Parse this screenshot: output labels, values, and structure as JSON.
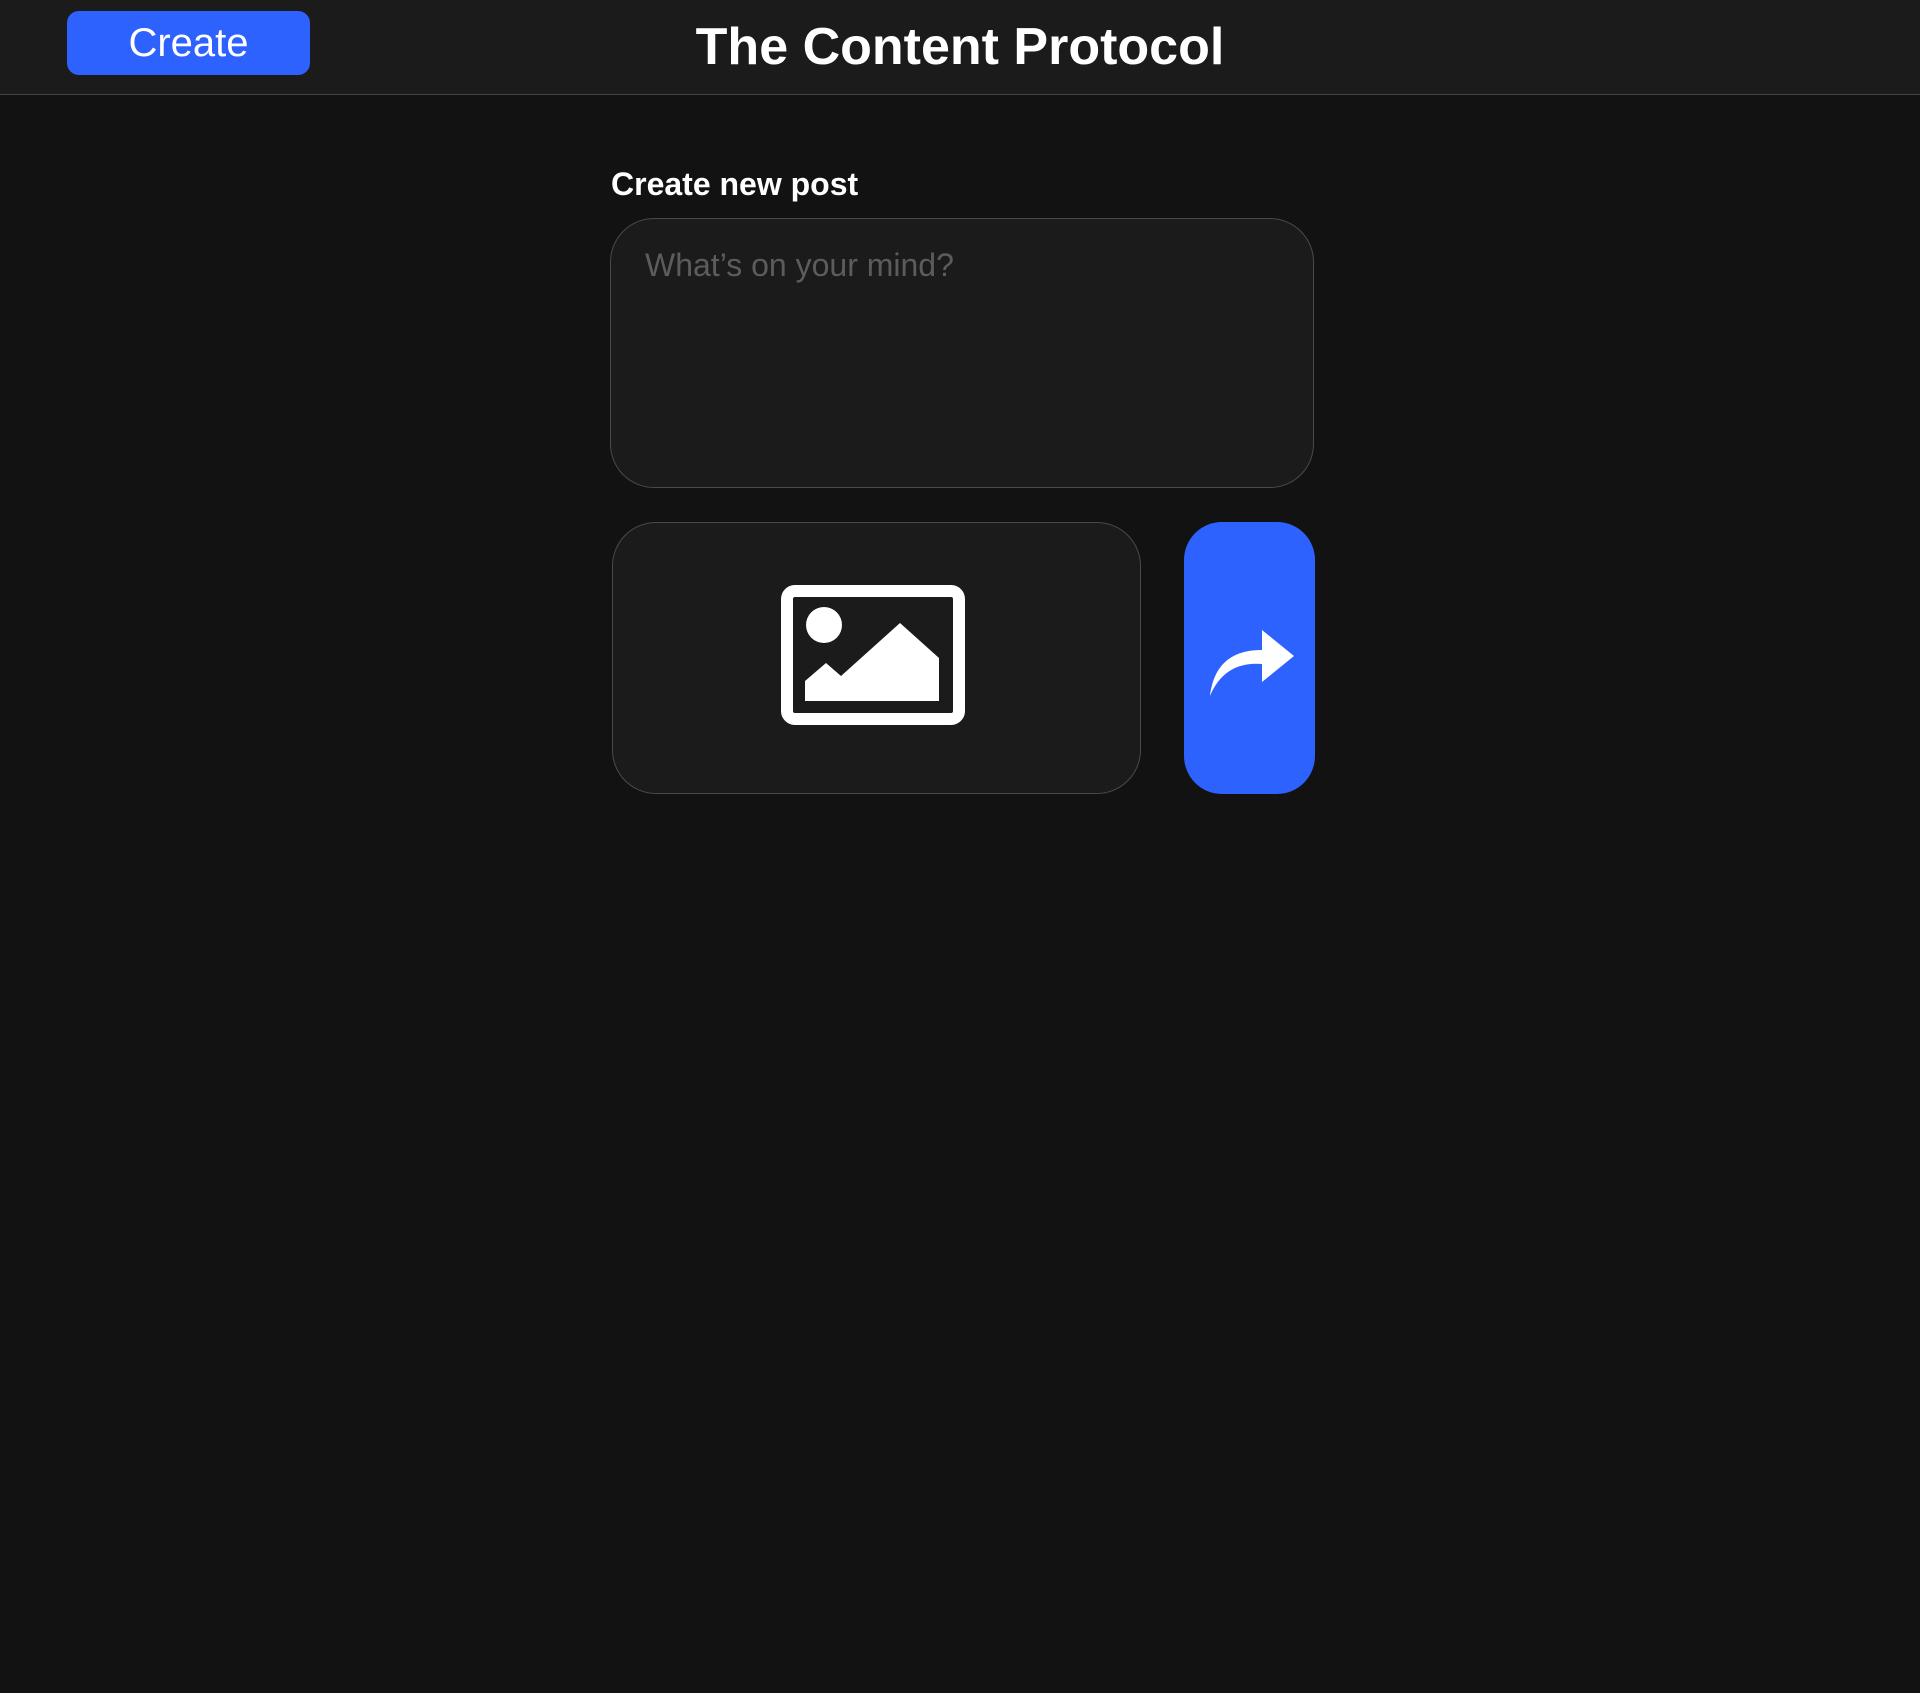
{
  "header": {
    "title": "The Content Protocol",
    "create_label": "Create"
  },
  "composer": {
    "heading": "Create new post",
    "placeholder": "What’s on your mind?",
    "value": "",
    "image_icon": "image-icon",
    "share_icon": "share-arrow-icon"
  },
  "colors": {
    "accent": "#2e62ff",
    "background": "#121212",
    "surface": "#1b1b1b",
    "border": "#4a4a4a",
    "placeholder": "#5c5c5c",
    "text": "#ffffff"
  }
}
